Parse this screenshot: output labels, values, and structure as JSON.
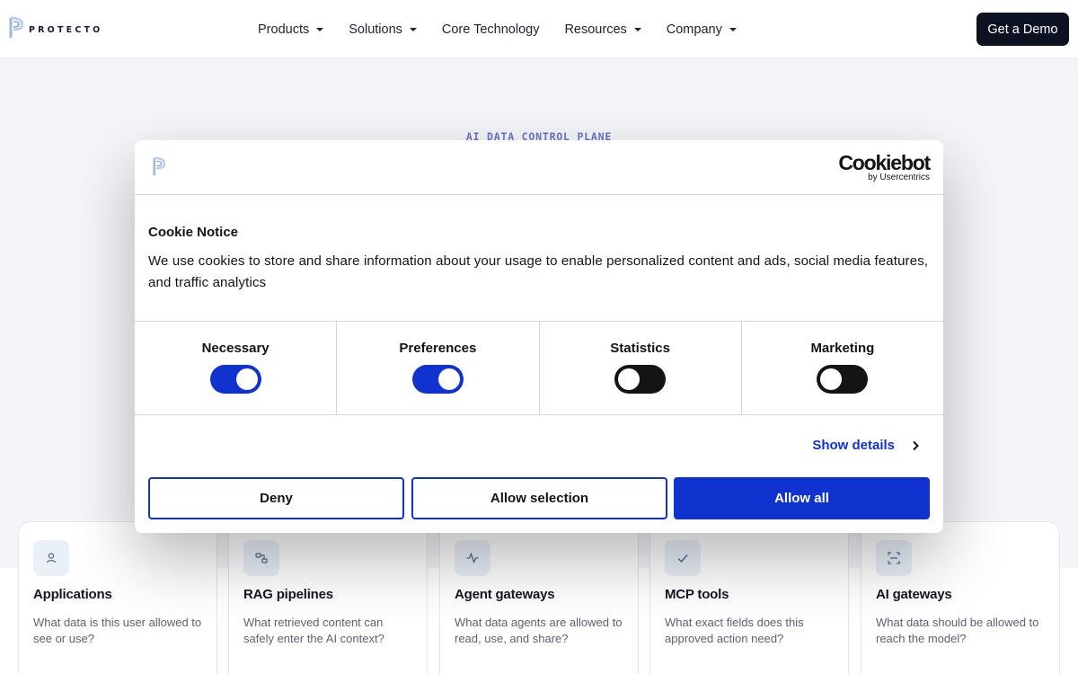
{
  "header": {
    "logo_text": "PROTECTO",
    "nav": [
      {
        "label": "Products",
        "dropdown": true
      },
      {
        "label": "Solutions",
        "dropdown": true
      },
      {
        "label": "Core Technology",
        "dropdown": false
      },
      {
        "label": "Resources",
        "dropdown": true
      },
      {
        "label": "Company",
        "dropdown": true
      }
    ],
    "cta": "Get a Demo"
  },
  "hero": {
    "eyebrow": "AI DATA CONTROL PLANE"
  },
  "cards": [
    {
      "icon": "user-icon",
      "title": "Applications",
      "text": "What data is this user allowed to see or use?"
    },
    {
      "icon": "pipeline-icon",
      "title": "RAG pipelines",
      "text": "What retrieved content can safely enter the AI context?"
    },
    {
      "icon": "activity-icon",
      "title": "Agent gateways",
      "text": "What data agents are allowed to read, use, and share?"
    },
    {
      "icon": "check-icon",
      "title": "MCP tools",
      "text": "What exact fields does this approved action need?"
    },
    {
      "icon": "scan-icon",
      "title": "AI gateways",
      "text": "What data should be allowed to reach the model?"
    }
  ],
  "cookie": {
    "brand": "Cookiebot",
    "brand_sub": "by Usercentrics",
    "title": "Cookie Notice",
    "text": "We use cookies to store and share information about your usage to enable personalized content and ads, social media features, and traffic analytics",
    "toggles": [
      {
        "label": "Necessary",
        "on": true
      },
      {
        "label": "Preferences",
        "on": true
      },
      {
        "label": "Statistics",
        "on": false
      },
      {
        "label": "Marketing",
        "on": false
      }
    ],
    "show_details": "Show details",
    "deny": "Deny",
    "allow_selection": "Allow selection",
    "allow_all": "Allow all"
  },
  "colors": {
    "accent": "#1032cf",
    "dark": "#0d1222",
    "eyebrow": "#6a72c9"
  }
}
